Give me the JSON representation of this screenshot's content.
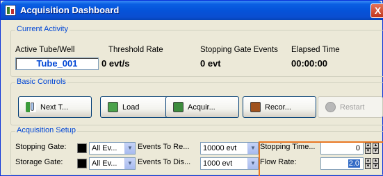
{
  "window": {
    "title": "Acquisition Dashboard",
    "close_glyph": "X"
  },
  "current_activity": {
    "group_label": "Current Activity",
    "headers": {
      "tube": "Active Tube/Well",
      "threshold": "Threshold Rate",
      "stopping": "Stopping Gate Events",
      "elapsed": "Elapsed Time"
    },
    "values": {
      "tube": "Tube_001",
      "threshold": "0 evt/s",
      "stopping": "0 evt",
      "elapsed": "00:00:00"
    }
  },
  "basic_controls": {
    "group_label": "Basic Controls",
    "buttons": [
      {
        "label": "Next T...",
        "icon": "next-tube-icon"
      },
      {
        "label": "Load",
        "icon": "load-icon"
      },
      {
        "label": "Acquir...",
        "icon": "acquire-icon"
      },
      {
        "label": "Recor...",
        "icon": "record-icon"
      },
      {
        "label": "Restart",
        "icon": "restart-icon"
      }
    ]
  },
  "acquisition_setup": {
    "group_label": "Acquisition Setup",
    "row1": {
      "gate_label": "Stopping Gate:",
      "gate_value": "All Ev...",
      "events_label": "Events To Re...",
      "events_value": "10000 evt",
      "time_label": "Stopping Time...",
      "time_value": "0"
    },
    "row2": {
      "gate_label": "Storage Gate:",
      "gate_value": "All Ev...",
      "events_label": "Events To Dis...",
      "events_value": "1000 evt",
      "flow_label": "Flow Rate:",
      "flow_value": "2.0"
    }
  },
  "colors": {
    "title_bar": "#0553d9",
    "group_label": "#0046d5",
    "tube_text": "#0046d5",
    "highlight": "#e87722"
  }
}
